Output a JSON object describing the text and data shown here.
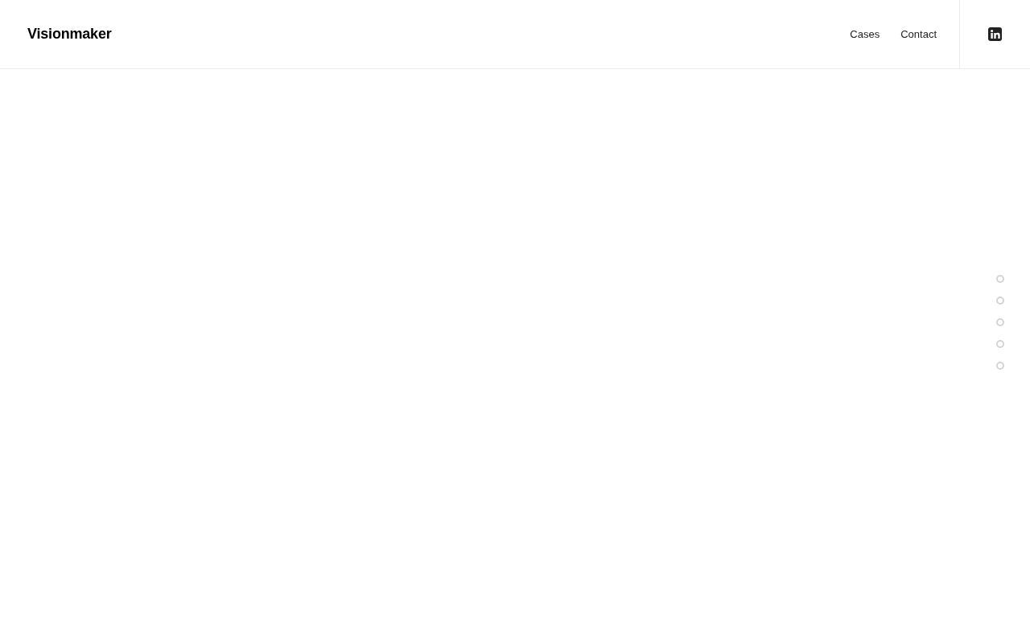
{
  "header": {
    "logo": "Visionmaker",
    "nav": [
      {
        "label": "Cases"
      },
      {
        "label": "Contact"
      }
    ]
  },
  "section_dots": [
    {
      "selected": false
    },
    {
      "selected": false
    },
    {
      "selected": false
    },
    {
      "selected": false
    },
    {
      "selected": false
    }
  ]
}
